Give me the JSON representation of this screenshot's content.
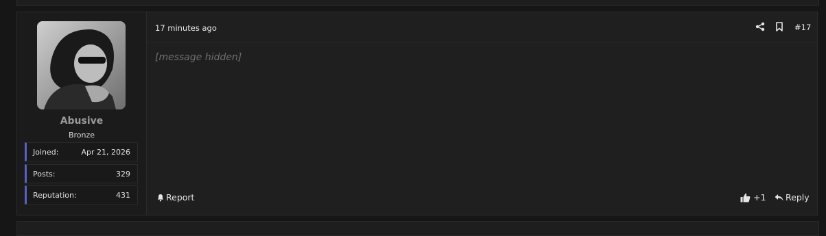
{
  "post": {
    "time": "17 minutes ago",
    "number": "#17",
    "body": "[message hidden]",
    "actions": {
      "report": "Report",
      "like": "+1",
      "reply": "Reply"
    }
  },
  "user": {
    "name": "Abusive",
    "title": "Bronze",
    "stats": [
      {
        "label": "Joined:",
        "value": "Apr 21, 2026"
      },
      {
        "label": "Posts:",
        "value": "329"
      },
      {
        "label": "Reputation:",
        "value": "431"
      }
    ]
  },
  "colors": {
    "accent": "#5b5fc7",
    "panel": "#1f1f1f",
    "user_panel": "#1b1b1b",
    "username": "#9a9a9a"
  },
  "icons": [
    "share-icon",
    "bookmark-icon",
    "bell-icon",
    "thumbs-up-icon",
    "reply-icon"
  ]
}
